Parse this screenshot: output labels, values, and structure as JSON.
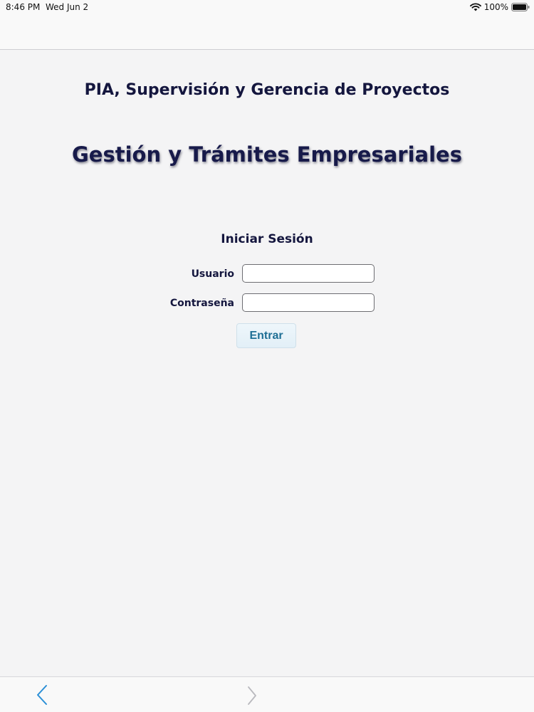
{
  "status_bar": {
    "time": "8:46 PM",
    "date": "Wed Jun 2",
    "battery": "100%",
    "icons": [
      "wifi-icon",
      "battery-icon"
    ]
  },
  "page": {
    "subtitle": "PIA, Supervisión y Gerencia de Proyectos",
    "title": "Gestión y Trámites Empresariales"
  },
  "login": {
    "heading": "Iniciar Sesión",
    "username_label": "Usuario",
    "username_value": "",
    "password_label": "Contraseña",
    "password_value": "",
    "submit_label": "Entrar"
  },
  "toolbar": {
    "icons": [
      "chevron-left-icon",
      "chevron-right-icon"
    ]
  },
  "colors": {
    "background": "#f4f4f5",
    "heading_text": "#14163e",
    "button_text": "#1e6f95",
    "ios_blue": "#2b8fd6"
  }
}
